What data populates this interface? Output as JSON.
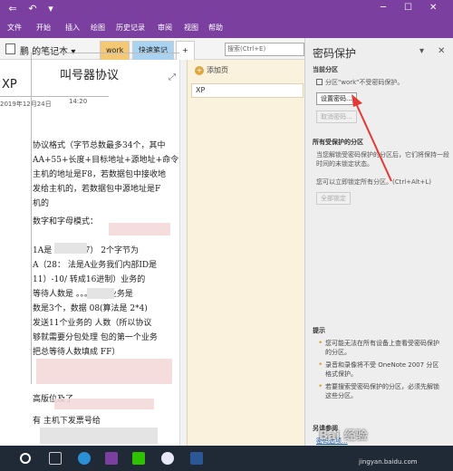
{
  "ribbon": {
    "tabs": [
      "文件",
      "开始",
      "插入",
      "绘图",
      "历史记录",
      "审阅",
      "视图",
      "帮助"
    ]
  },
  "notebook": {
    "name": "鹏 的笔记本",
    "sections": [
      {
        "label": "work",
        "color": "#f4c875"
      },
      {
        "label": "快速笔记",
        "color": "#a9d3f0"
      }
    ],
    "add_section": "+",
    "search_placeholder": "搜索(Ctrl+E)"
  },
  "page": {
    "title": "XP",
    "date": "2019年12月24日",
    "time": "14:20"
  },
  "document": {
    "heading": "叫号器协议",
    "lines": [
      "协议格式（字节总数最多34个，其中",
      "AA+55+长度+目标地址+源地址+命令",
      "主机的地址是F8，若数据包中接收地",
      "发给主机的，若数据包中源地址是F",
      "机的",
      "数字和字母模式：",
      "1A是        ：（00 07）  2个字节为",
      "A（28：    法是A业务我们内部ID是",
      "11）-10/    转成16进制）业务的",
      "等待人数是     。。。如果业务是",
      "数是3个，数据       08(算法是 2*4)",
      "发送11个业务的         人数（所以协议",
      "够就需要分包处理        包的第一个业务",
      "把总等待人数填成       FF）",
      "高版位及了",
      "有         主机下发票号给"
    ]
  },
  "pagelist": {
    "add_page": "添加页",
    "pages": [
      "XP"
    ]
  },
  "pane": {
    "title": "密码保护",
    "current_section_header": "当前分区",
    "current_section_status": "分区\"work\"不受密码保护。",
    "set_password": "设置密码...",
    "remove_password": "取消密码...",
    "all_header": "所有受保护的分区",
    "all_desc": "当您解锁受密码保护的分区后，它们将保持一段时间的未锁定状态。",
    "lock_desc": "您可以立即锁定所有分区。(Ctrl+Alt+L)",
    "lock_all": "全部锁定",
    "tips_header": "提示",
    "tips": [
      "您可能无法在所有设备上查看受密码保护的分区。",
      "录音和录像将不受 OneNote 2007 分区格式保护。",
      "若要搜索受密码保护的分区，必须先解锁这些分区。"
    ],
    "see_also_header": "另请参阅",
    "see_also_link": "密码选项..."
  },
  "watermark": {
    "text": "Bai 经验",
    "url": "jingyan.baidu.com"
  },
  "colors": {
    "accent": "#7b3fa0",
    "pagelist_bg": "#fbf2dd",
    "arrow": "#e53935"
  }
}
